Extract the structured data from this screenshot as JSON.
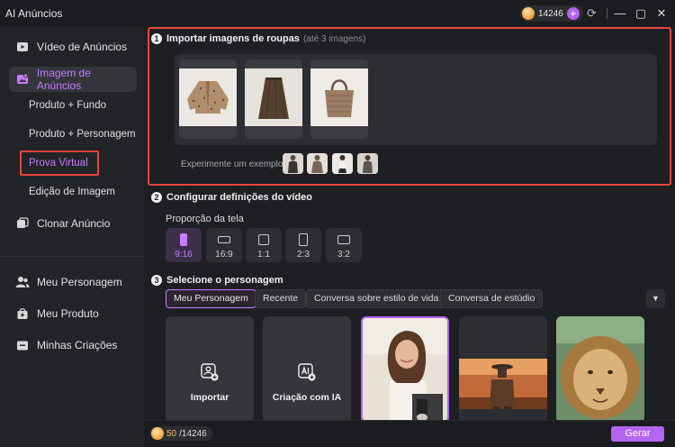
{
  "app": {
    "title": "AI Anúncios",
    "credits": "14246"
  },
  "sidebar": {
    "items": [
      {
        "label": "Vídeo de Anúncios",
        "icon": "video-icon"
      },
      {
        "label": "Imagem de Anúncios",
        "icon": "image-ad-icon"
      },
      {
        "label": "Clonar Anúncio",
        "icon": "clone-icon"
      },
      {
        "label": "Meu Personagem",
        "icon": "people-icon"
      },
      {
        "label": "Meu Produto",
        "icon": "product-bag-icon"
      },
      {
        "label": "Minhas Criações",
        "icon": "folder-icon"
      }
    ],
    "subitems": [
      {
        "label": "Produto + Fundo"
      },
      {
        "label": "Produto + Personagem"
      },
      {
        "label": "Prova Virtual"
      },
      {
        "label": "Edição de Imagem"
      }
    ]
  },
  "section1": {
    "number": "1",
    "title": "Importar imagens de roupas",
    "note": "(até 3 imagens)",
    "thumbnails": [
      "cardigan",
      "skirt",
      "bag"
    ],
    "try_label": "Experimente um exemplo:"
  },
  "section2": {
    "number": "2",
    "title": "Configurar definições do vídeo",
    "ratio_label": "Proporção da tela",
    "ratios": [
      {
        "label": "9:16",
        "selected": true
      },
      {
        "label": "16:9",
        "selected": false
      },
      {
        "label": "1:1",
        "selected": false
      },
      {
        "label": "2:3",
        "selected": false
      },
      {
        "label": "3:2",
        "selected": false
      }
    ]
  },
  "section3": {
    "number": "3",
    "title": "Selecione o personagem",
    "tabs": [
      {
        "label": "Meu Personagem",
        "selected": true
      },
      {
        "label": "Recente"
      },
      {
        "label": "Conversa sobre estilo de vida"
      },
      {
        "label": "Conversa de estúdio"
      }
    ],
    "cards": [
      {
        "label": "Importar",
        "icon": "import-person-icon"
      },
      {
        "label": "Criação com IA",
        "icon": "ai-create-icon"
      }
    ]
  },
  "footer": {
    "used": "50",
    "total": "/14246",
    "generate_label": "Gerar"
  },
  "colors": {
    "accent": "#b565f0",
    "highlight": "#e8453c",
    "background": "#1e1f22"
  }
}
